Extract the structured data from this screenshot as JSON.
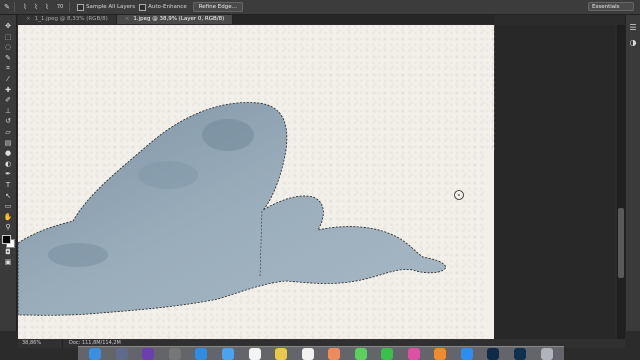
{
  "options_bar": {
    "sample_all_layers": "Sample All Layers",
    "auto_enhance": "Auto-Enhance",
    "refine_edge": "Refine Edge...",
    "brush_size": "70",
    "workspace": "Essentials"
  },
  "tabs": [
    {
      "label": "1_1.jpeg @ 8,33% (RGB/8)"
    },
    {
      "label": "1.jpeg @ 38,9% (Layer 0, RGB/8)"
    }
  ],
  "status": {
    "zoom": "38,86%",
    "doc": "Doc: 111,8M/114,2M"
  },
  "icons": {
    "tools": [
      "move-icon",
      "marquee-icon",
      "lasso-icon",
      "quick-selection-icon",
      "crop-icon",
      "eyedropper-icon",
      "healing-icon",
      "brush-icon",
      "clone-stamp-icon",
      "history-brush-icon",
      "eraser-icon",
      "gradient-icon",
      "blur-icon",
      "dodge-icon",
      "pen-icon",
      "type-icon",
      "path-selection-icon",
      "shape-icon",
      "hand-icon",
      "zoom-icon"
    ]
  },
  "colors": {
    "paper": "#f3f0ea",
    "paint": "#93a6b4",
    "paint_dark": "#6f8596"
  }
}
